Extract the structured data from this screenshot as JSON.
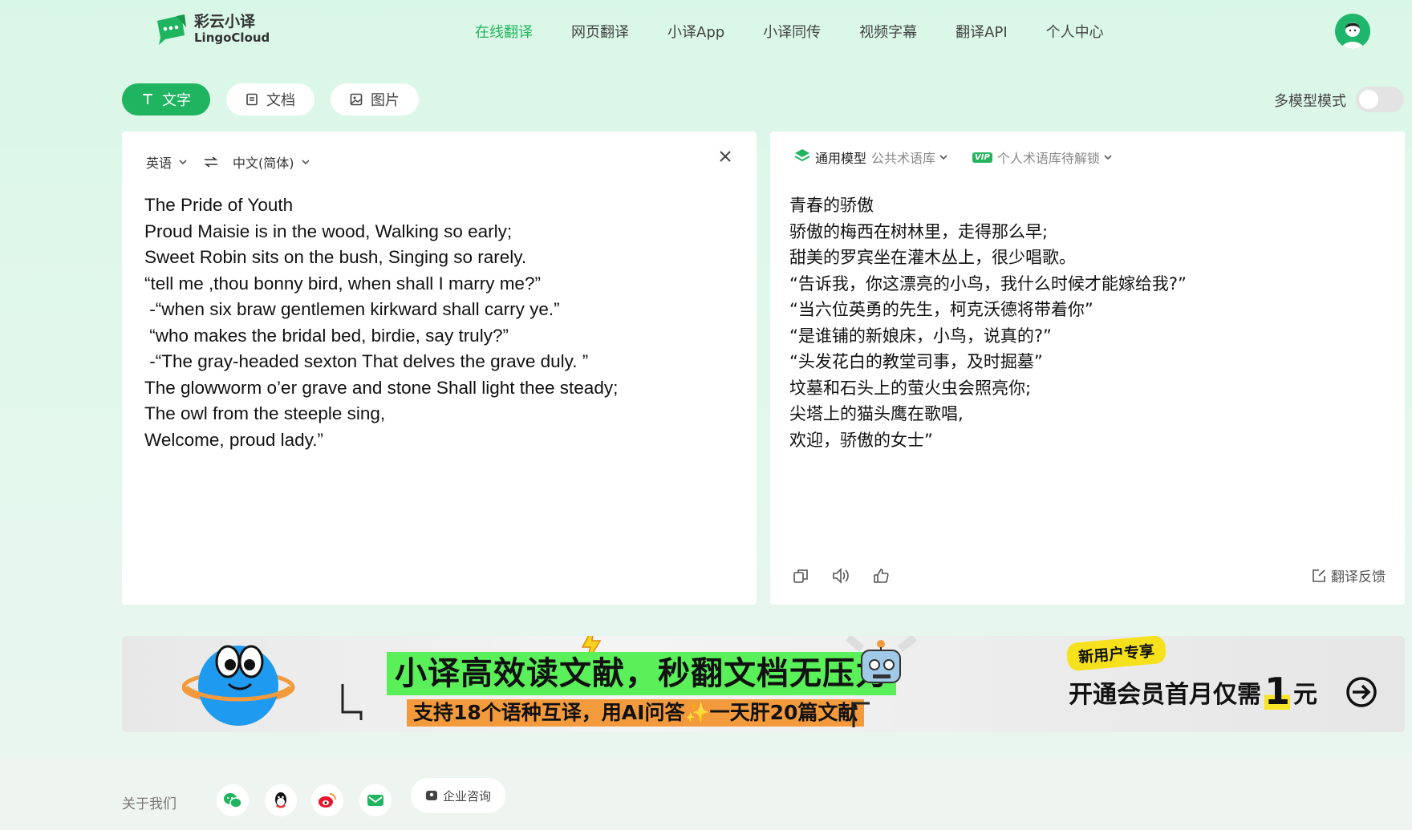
{
  "brand": {
    "name_cn": "彩云小译",
    "name_en": "LingoCloud"
  },
  "nav": [
    {
      "label": "在线翻译",
      "active": true
    },
    {
      "label": "网页翻译"
    },
    {
      "label": "小译App"
    },
    {
      "label": "小译同传"
    },
    {
      "label": "视频字幕"
    },
    {
      "label": "翻译API"
    },
    {
      "label": "个人中心"
    }
  ],
  "mode_tabs": [
    {
      "label": "文字",
      "icon": "text-icon",
      "active": true
    },
    {
      "label": "文档",
      "icon": "document-icon"
    },
    {
      "label": "图片",
      "icon": "image-icon"
    }
  ],
  "multi_model": {
    "label": "多模型模式",
    "enabled": false
  },
  "source": {
    "language": "英语",
    "target_language": "中文(简体)",
    "text": "The Pride of Youth\nProud Maisie is in the wood, Walking so early;\nSweet Robin sits on the bush, Singing so rarely.\n“tell me ,thou bonny bird, when shall I marry me?”\n -“when six braw gentlemen kirkward shall carry ye.”\n “who makes the bridal bed, birdie, say truly?”\n -“The gray-headed sexton That delves the grave duly. ”\nThe glowworm o’er grave and stone Shall light thee steady;\nThe owl from the steeple sing,\nWelcome, proud lady.”"
  },
  "target": {
    "model_name": "通用模型",
    "model_sub": "公共术语库",
    "vip": "VIP",
    "personal_glossary": "个人术语库待解锁",
    "text": "青春的骄傲\n骄傲的梅西在树林里，走得那么早;\n甜美的罗宾坐在灌木丛上，很少唱歌。\n“告诉我，你这漂亮的小鸟，我什么时候才能嫁给我?”\n“当六位英勇的先生，柯克沃德将带着你”\n“是谁铺的新娘床，小鸟，说真的?”\n“头发花白的教堂司事，及时掘墓”\n坟墓和石头上的萤火虫会照亮你;\n尖塔上的猫头鹰在歌唱,\n欢迎，骄傲的女士”",
    "feedback": "翻译反馈"
  },
  "banner": {
    "headline": "小译高效读文献，秒翻文档无压力",
    "subline": "支持18个语种互译，用AI问答✨一天肝20篇文献",
    "new_user": "新用户专享",
    "offer_prefix": "开通会员首月仅需",
    "offer_amount": "1",
    "offer_suffix": "元"
  },
  "footer": {
    "about": "关于我们",
    "social": [
      "wechat-icon",
      "qq-icon",
      "weibo-icon",
      "mail-icon"
    ],
    "consult": "企业咨询"
  },
  "colors": {
    "accent": "#1fb45f",
    "background": "#d9f7e7"
  }
}
